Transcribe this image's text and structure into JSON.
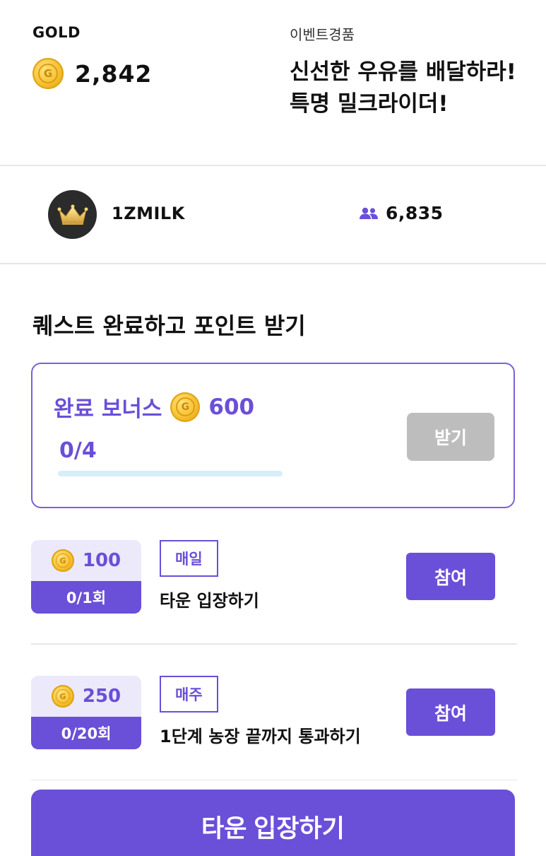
{
  "header": {
    "gold_label": "GOLD",
    "gold_value": "2,842",
    "event_label": "이벤트경품",
    "event_title": "신선한 우유를 배달하라! 특명 밀크라이더!",
    "coin_icon": "coin-icon"
  },
  "profile": {
    "avatar_icon": "crown-icon",
    "username": "1ZMILK",
    "members_icon": "people-icon",
    "members_count": "6,835"
  },
  "quests": {
    "section_title": "퀘스트 완료하고 포인트 받기",
    "bonus": {
      "label": "완료 보너스",
      "amount": "600",
      "progress_text": "0/4",
      "progress_fraction": 0,
      "receive_label": "받기"
    },
    "items": [
      {
        "reward": "100",
        "count": "0/1회",
        "frequency": "매일",
        "name": "타운 입장하기",
        "join_label": "참여"
      },
      {
        "reward": "250",
        "count": "0/20회",
        "frequency": "매주",
        "name": "1단계 농장 끝까지 통과하기",
        "join_label": "참여"
      }
    ]
  },
  "cta": {
    "label": "타운 입장하기"
  },
  "colors": {
    "accent": "#6a4fd8",
    "disabled": "#bdbdbd",
    "coin": "#f6c02e",
    "progress_track": "#d6eef8"
  }
}
